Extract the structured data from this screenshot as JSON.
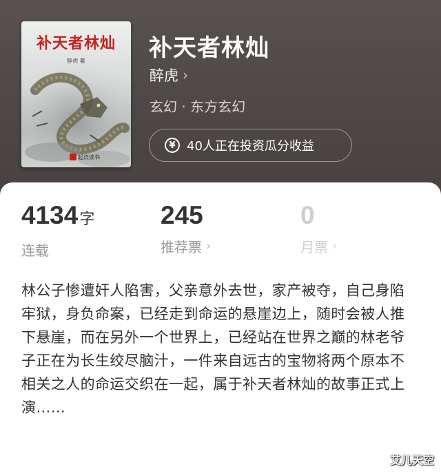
{
  "book": {
    "cover_title": "补天者林灿",
    "cover_author": "醉虎 著",
    "cover_publisher": "起点读书",
    "title": "补天者林灿",
    "author": "醉虎",
    "genre": "玄幻 · 东方玄幻"
  },
  "invest": {
    "icon": "yen-icon",
    "label": "40人正在投资瓜分收益"
  },
  "stats": {
    "words": {
      "value": "4134",
      "unit": "字",
      "label": "连载"
    },
    "recommend": {
      "value": "245",
      "label": "推荐票"
    },
    "monthly": {
      "value": "0",
      "label": "月票"
    }
  },
  "description": "林公子惨遭奸人陷害，父亲意外去世，家产被夺，自己身陷牢狱，身负命案，已经走到命运的悬崖边上，随时会被人推下悬崖，而在另外一个世界上，已经站在世界之巅的林老爷子正在为长生绞尽脑汁，一件来自远古的宝物将两个原本不相关之人的命运交织在一起，属于补天者林灿的故事正式上演……",
  "watermark": "艾儿天空",
  "colors": {
    "cover_title": "#c8211b",
    "header_bg": "#4d4847",
    "text_primary": "#333333",
    "text_secondary": "#999999"
  }
}
